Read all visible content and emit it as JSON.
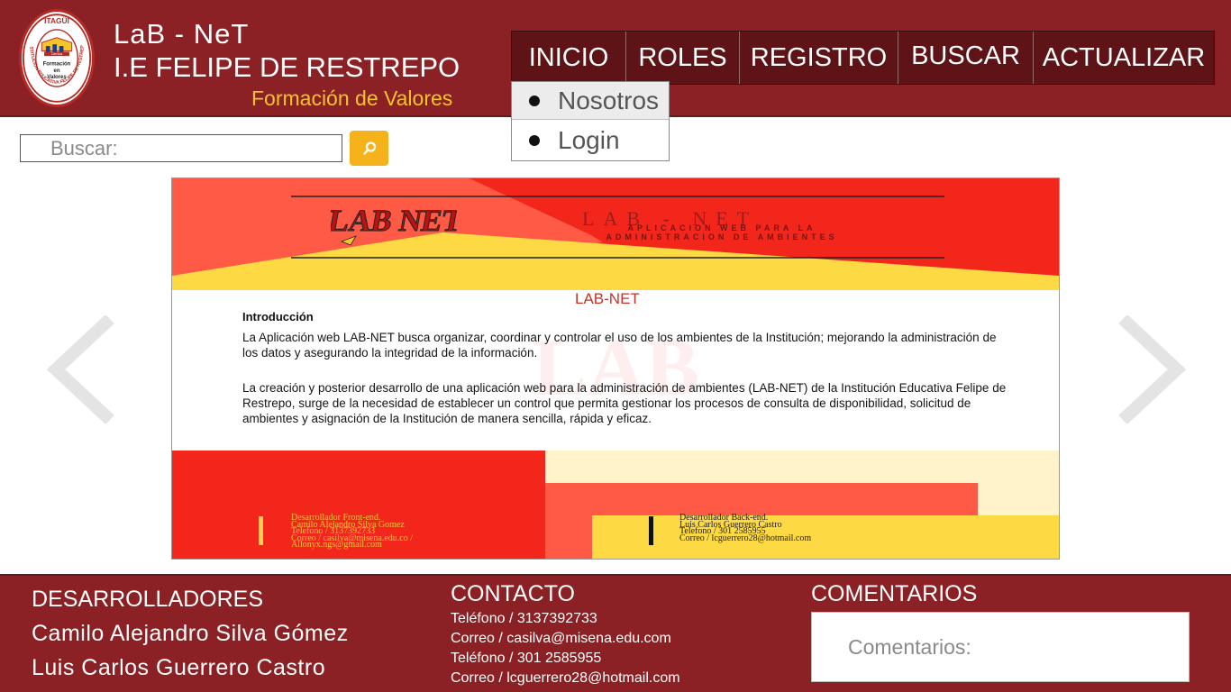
{
  "header": {
    "title": "LaB - NeT",
    "school": "I.E FELIPE DE RESTREPO",
    "slogan": "Formación de Valores",
    "logo_text": {
      "city": "ITAGÜÍ",
      "institution": "INSTITUCIÓN EDUCATIVA FELIPE DE RESTREPO",
      "center_1": "Formación",
      "center_2": "en",
      "center_3": "Valores",
      "ribbon": "Ciencia"
    }
  },
  "nav": {
    "items": [
      {
        "label": "INICIO"
      },
      {
        "label": "ROLES"
      },
      {
        "label": "REGISTRO"
      },
      {
        "label": "BUSCAR"
      },
      {
        "label": "ACTUALIZAR"
      }
    ],
    "dropdown": [
      {
        "label": "Nosotros"
      },
      {
        "label": "Login"
      }
    ]
  },
  "search": {
    "placeholder": "Buscar:",
    "icon": "search-icon"
  },
  "carousel": {
    "prev_icon": "chevron-left-icon",
    "next_icon": "chevron-right-icon",
    "slide": {
      "logo_text": "LAB NET",
      "app_name": "LAB - NET",
      "subtitle_1": "APLICACION WEB PARA LA",
      "subtitle_2": "ADMINISTRACION DE AMBIENTES",
      "section_title": "LAB-NET",
      "intro_title": "Introducción",
      "paragraph_1": "La Aplicación web LAB-NET busca organizar, coordinar y controlar el uso de los ambientes de la Institución; mejorando la administración de los datos y asegurando la integridad de la información.",
      "paragraph_2": "La creación y posterior desarrollo de una aplicación web para la administración de ambientes (LAB-NET) de la Institución Educativa Felipe de Restrepo, surge de la necesidad de establecer un control que permita gestionar los procesos de consulta de disponibilidad, solicitud de ambientes y asignación de la Institución de manera sencilla, rápida y eficaz.",
      "front_dev": {
        "role": "Desarrollador Front-end.",
        "name": "Camilo Alejandro Silva Gomez",
        "phone": "Telefono / 3137392733",
        "email": "Correo / casilva@misena.edu.co /",
        "email_2": "Allonyx.ngs@gmail.com"
      },
      "back_dev": {
        "role": "Desarrollador Back-end.",
        "name": "Luis Carlos Guerrero Castro",
        "phone": "Telefono / 301 2585955",
        "email": "Correo / lcguerrero28@hotmail.com"
      }
    },
    "colors": {
      "red": "#f3261c",
      "coral": "#ff5a45",
      "yellow": "#fdd943",
      "cream": "#fff3cc"
    }
  },
  "footer": {
    "developers_heading": "DESARROLLADORES",
    "developers": [
      "Camilo Alejandro Silva Gómez",
      "Luis Carlos Guerrero Castro"
    ],
    "contact_heading": "CONTACTO",
    "contact_lines": [
      "Teléfono / 3137392733",
      "Correo / casilva@misena.edu.com",
      "Teléfono / 301 2585955",
      "Correo / lcguerrero28@hotmail.com"
    ],
    "comments_heading": "COMENTARIOS",
    "comments_placeholder": "Comentarios:"
  },
  "theme": {
    "primary": "#8b2124",
    "nav_bg": "#5e1416",
    "accent": "#f6b21a",
    "slogan_color": "#f3c52c"
  }
}
